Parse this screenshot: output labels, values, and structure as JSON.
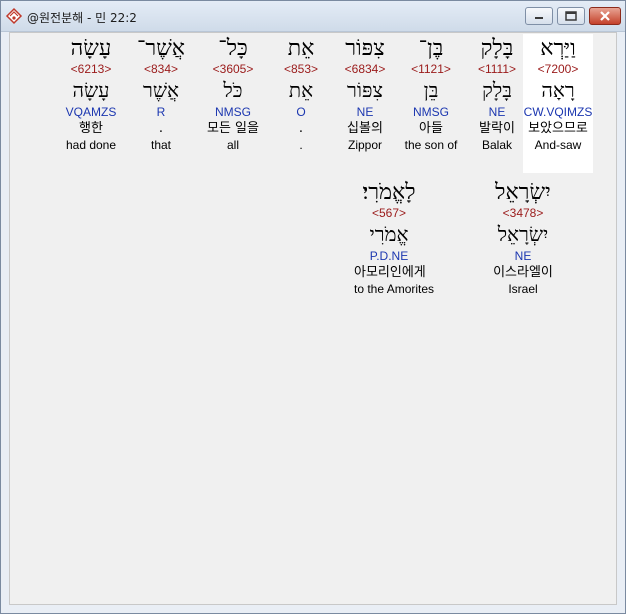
{
  "window": {
    "title": "@원전분해 - 민 22:2",
    "controls": {
      "minimize": "–",
      "maximize": "□",
      "close": "✕"
    }
  },
  "rows": [
    [
      {
        "heb": "וַיַּרְא",
        "strong": "<7200>",
        "lemma": "רָאָה",
        "morph": "CW.VQIMZS",
        "kor": "보았으므로",
        "eng": "And-saw",
        "highlight": true
      },
      {
        "heb": "בָּלָק",
        "strong": "<1111>",
        "lemma": "בָּלָק",
        "morph": "NE",
        "kor": "발락이",
        "eng": "Balak",
        "highlight": false
      },
      {
        "heb": "בֶּן־",
        "strong": "<1121>",
        "lemma": "בֵּן",
        "morph": "NMSG",
        "kor": "아들",
        "eng": "the son of",
        "highlight": false
      },
      {
        "heb": "צִפּוֹר",
        "strong": "<6834>",
        "lemma": "צִפּוֹר",
        "morph": "NE",
        "kor": "십볼의",
        "eng": "Zippor",
        "highlight": false
      },
      {
        "heb": "אֵת",
        "strong": "<853>",
        "lemma": "אֵת",
        "morph": "O",
        "kor": ".",
        "eng": ".",
        "highlight": false
      },
      {
        "heb": "כָּל־",
        "strong": "<3605>",
        "lemma": "כֹּל",
        "morph": "NMSG",
        "kor": "모든 일을",
        "eng": "all",
        "highlight": false
      },
      {
        "heb": "אֲשֶׁר־",
        "strong": "<834>",
        "lemma": "אֲשֶׁר",
        "morph": "R",
        "kor": ".",
        "eng": "that",
        "highlight": false
      },
      {
        "heb": "עָשָׂה",
        "strong": "<6213>",
        "lemma": "עָשָׂה",
        "morph": "VQAMZS",
        "kor": "행한",
        "eng": "had done",
        "highlight": false
      }
    ],
    [
      {
        "heb": "יִשְׂרָאֵל",
        "strong": "<3478>",
        "lemma": "יִשְׂרָאֵל",
        "morph": "NE",
        "kor": "이스라엘이",
        "eng": "Israel",
        "highlight": false
      },
      {
        "heb": "לָאֱמֹרִי׃",
        "strong": "<567>",
        "lemma": "אֱמֹרִי",
        "morph": "P.D.NE",
        "kor": "아모리인에게",
        "eng": "to the Amorites",
        "highlight": false
      }
    ]
  ]
}
